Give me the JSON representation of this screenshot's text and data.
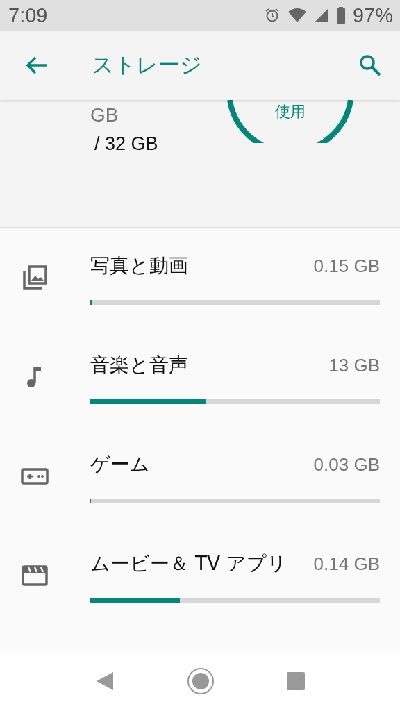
{
  "status_bar": {
    "time": "7:09",
    "battery": "97%"
  },
  "toolbar": {
    "title": "ストレージ"
  },
  "summary": {
    "used_unit": "GB",
    "total": "/ 32 GB",
    "gauge_label": "使用"
  },
  "categories": [
    {
      "kind": "photos",
      "label": "写真と動画",
      "size": "0.15 GB",
      "level": 0.005
    },
    {
      "kind": "music",
      "label": "音楽と音声",
      "size": "13 GB",
      "level": 0.4
    },
    {
      "kind": "games",
      "label": "ゲーム",
      "size": "0.03 GB",
      "level": 0.003
    },
    {
      "kind": "movies",
      "label": "ムービー＆ TV アプリ",
      "size": "0.14 GB",
      "level": 0.31
    }
  ]
}
